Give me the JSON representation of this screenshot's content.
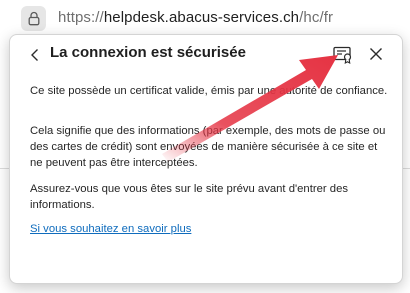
{
  "address_bar": {
    "lock_icon": "lock-icon",
    "url_scheme": "https://",
    "url_host": "helpdesk.abacus-services.ch",
    "url_path": "/hc/fr"
  },
  "popup": {
    "title": "La connexion est sécurisée",
    "back_icon": "chevron-left-icon",
    "certificate_icon": "certificate-icon",
    "close_icon": "close-icon",
    "paragraph_1": "Ce site possède un certificat valide, émis par une autorité de confiance.",
    "paragraph_2": "Cela signifie que des informations (par exemple, des mots de passe ou des cartes de crédit) sont envoyées de manière sécurisée à ce site et ne peuvent pas être interceptées.",
    "paragraph_3": "Assurez-vous que vous êtes sur le site prévu avant d'entrer des informations.",
    "learn_more_link": "Si vous souhaitez en savoir plus"
  },
  "colors": {
    "link": "#0f6cbd",
    "annotation_arrow": "#e53343"
  }
}
